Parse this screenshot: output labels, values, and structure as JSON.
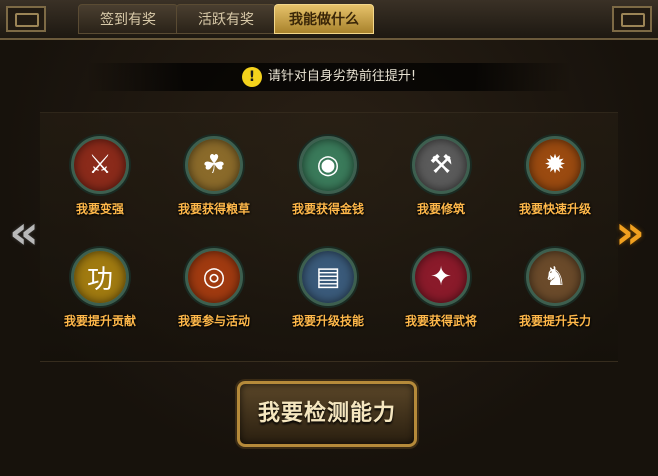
{
  "tabs": [
    {
      "label": "签到有奖",
      "active": false
    },
    {
      "label": "活跃有奖",
      "active": false
    },
    {
      "label": "我能做什么",
      "active": true
    }
  ],
  "notice": {
    "icon": "warning-icon",
    "text": "请针对自身劣势前往提升!"
  },
  "items": [
    {
      "label": "我要变强",
      "icon": "crossed-swords-icon",
      "glyph": "⚔",
      "bg": "#8a2a1a"
    },
    {
      "label": "我要获得粮草",
      "icon": "grain-sack-icon",
      "glyph": "☘",
      "bg": "#8a6a2a"
    },
    {
      "label": "我要获得金钱",
      "icon": "money-bag-icon",
      "glyph": "◉",
      "bg": "#3a7a5a"
    },
    {
      "label": "我要修筑",
      "icon": "hammer-icon",
      "glyph": "⚒",
      "bg": "#5a5a5a"
    },
    {
      "label": "我要快速升级",
      "icon": "fire-emblem-icon",
      "glyph": "✹",
      "bg": "#9a4a10"
    },
    {
      "label": "我要提升贡献",
      "icon": "merit-medal-icon",
      "glyph": "功",
      "bg": "#a07a10"
    },
    {
      "label": "我要参与活动",
      "icon": "target-icon",
      "glyph": "◎",
      "bg": "#a03a10"
    },
    {
      "label": "我要升级技能",
      "icon": "skill-book-icon",
      "glyph": "▤",
      "bg": "#3a5a7a"
    },
    {
      "label": "我要获得武将",
      "icon": "general-banner-icon",
      "glyph": "✦",
      "bg": "#8a1a2a"
    },
    {
      "label": "我要提升兵力",
      "icon": "soldiers-icon",
      "glyph": "♞",
      "bg": "#6a4a2a"
    }
  ],
  "nav": {
    "prev": "«",
    "next": "»"
  },
  "main_button": {
    "label": "我要检测能力"
  }
}
